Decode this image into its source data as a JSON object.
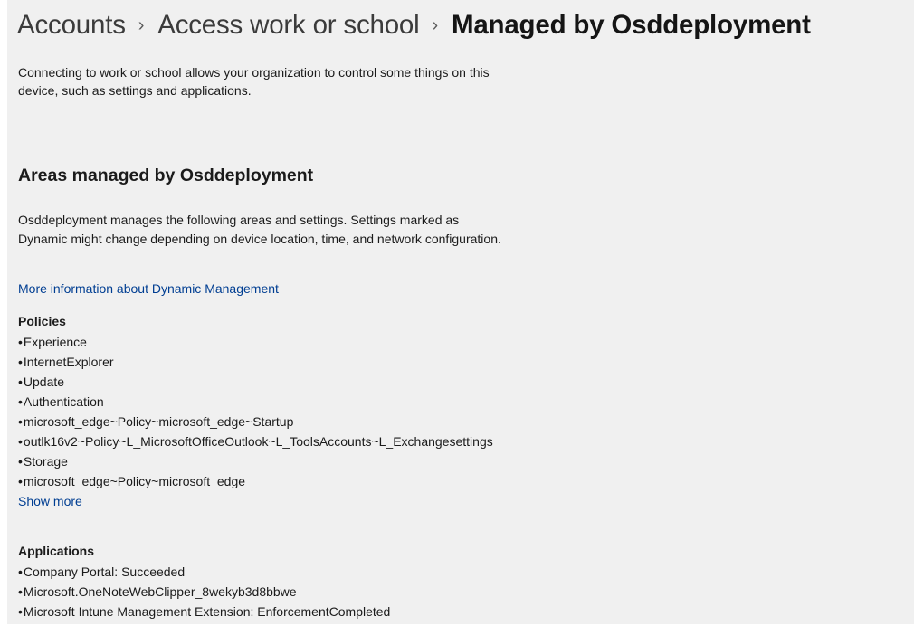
{
  "breadcrumb": {
    "items": [
      "Accounts",
      "Access work or school"
    ],
    "separator": "›",
    "current": "Managed by Osddeployment"
  },
  "intro": "Connecting to work or school allows your organization to control some things on this device, such as settings and applications.",
  "areas": {
    "heading": "Areas managed by Osddeployment",
    "description": "Osddeployment manages the following areas and settings. Settings marked as Dynamic might change depending on device location, time, and network configuration.",
    "more_info_link": "More information about Dynamic Management"
  },
  "policies": {
    "title": "Policies",
    "bullet": "•",
    "items": [
      "Experience",
      "InternetExplorer",
      "Update",
      "Authentication",
      "microsoft_edge~Policy~microsoft_edge~Startup",
      "outlk16v2~Policy~L_MicrosoftOfficeOutlook~L_ToolsAccounts~L_Exchangesettings",
      "Storage",
      "microsoft_edge~Policy~microsoft_edge"
    ],
    "show_more": "Show more"
  },
  "applications": {
    "title": "Applications",
    "items": [
      "Company Portal: Succeeded",
      "Microsoft.OneNoteWebClipper_8wekyb3d8bbwe",
      "Microsoft Intune Management Extension: EnforcementCompleted"
    ]
  },
  "colors": {
    "background": "#f0f0f0",
    "link": "#003e92",
    "text": "#1b1b1b"
  }
}
